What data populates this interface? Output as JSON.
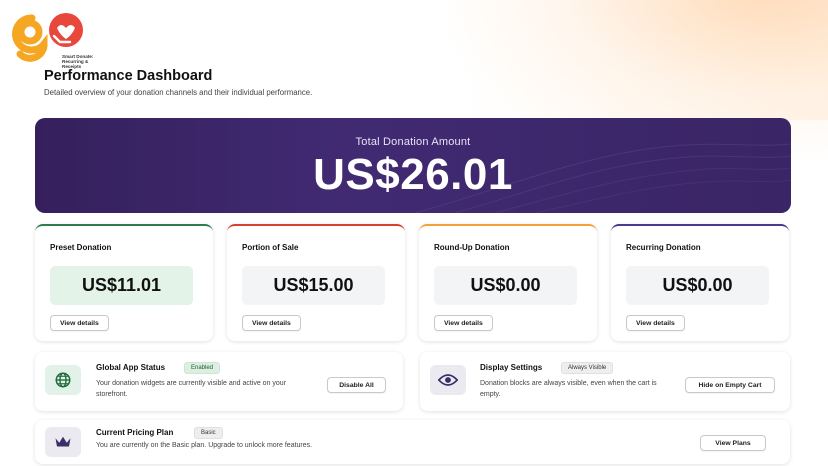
{
  "brand": {
    "logo_text": "Smart Donate: Recurring & Receipts",
    "colors": {
      "orange": "#f5a623",
      "red": "#e8473c"
    }
  },
  "header": {
    "title": "Performance Dashboard",
    "subtitle": "Detailed overview of your donation channels and their individual performance."
  },
  "total": {
    "label": "Total Donation Amount",
    "value": "US$26.01"
  },
  "cards": [
    {
      "title": "Preset Donation",
      "value": "US$11.01",
      "button": "View details",
      "accent": "#2e7d4f"
    },
    {
      "title": "Portion of Sale",
      "value": "US$15.00",
      "button": "View details",
      "accent": "#d9412f"
    },
    {
      "title": "Round-Up Donation",
      "value": "US$0.00",
      "button": "View details",
      "accent": "#f2a23a"
    },
    {
      "title": "Recurring Donation",
      "value": "US$0.00",
      "button": "View details",
      "accent": "#4b3a8c"
    }
  ],
  "app_status": {
    "title": "Global App Status",
    "badge": "Enabled",
    "description": "Your donation widgets are currently visible and active on your storefront.",
    "button": "Disable All",
    "icon": "globe-icon"
  },
  "display_settings": {
    "title": "Display Settings",
    "badge": "Always Visible",
    "description": "Donation blocks are always visible, even when the cart is empty.",
    "button": "Hide on Empty Cart",
    "icon": "eye-icon"
  },
  "pricing": {
    "title": "Current Pricing Plan",
    "badge": "Basic",
    "description": "You are currently on the Basic plan. Upgrade to unlock more features.",
    "button": "View Plans",
    "icon": "crown-icon"
  }
}
